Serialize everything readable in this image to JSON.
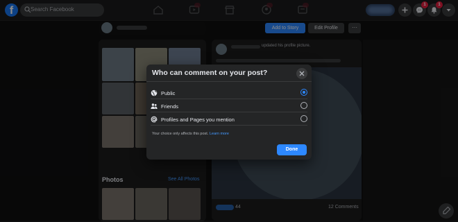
{
  "topbar": {
    "search_placeholder": "Search Facebook",
    "notif_messenger_count": "1",
    "notif_bell_count": "1"
  },
  "background": {
    "add_to_story": "Add to Story",
    "edit_profile": "Edit Profile",
    "updated_text": "updated his profile picture.",
    "photos_title": "Photos",
    "see_all_photos": "See All Photos",
    "comments_count": "12 Comments",
    "reaction_count": "44"
  },
  "modal": {
    "title": "Who can comment on your post?",
    "options": [
      {
        "label": "Public",
        "icon": "globe-icon",
        "selected": true
      },
      {
        "label": "Friends",
        "icon": "friends-icon",
        "selected": false
      },
      {
        "label": "Profiles and Pages you mention",
        "icon": "at-icon",
        "selected": false
      }
    ],
    "note": "Your choice only affects this post.",
    "learn_more": "Learn more",
    "done_label": "Done"
  },
  "colors": {
    "accent": "#2d88ff",
    "badge": "#e41e3f",
    "modal_bg": "#242526"
  }
}
